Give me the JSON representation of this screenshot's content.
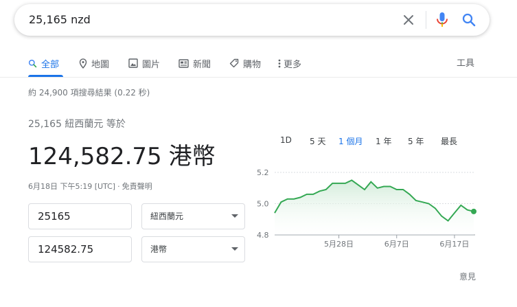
{
  "search": {
    "query": "25,165 nzd",
    "icons": [
      "close-icon",
      "mic-icon",
      "search-icon"
    ]
  },
  "tabs": {
    "items": [
      {
        "label": "全部",
        "icon": "search-icon",
        "active": true
      },
      {
        "label": "地圖",
        "icon": "map-pin-icon"
      },
      {
        "label": "圖片",
        "icon": "image-icon"
      },
      {
        "label": "新聞",
        "icon": "news-icon"
      },
      {
        "label": "購物",
        "icon": "tag-icon"
      },
      {
        "label": "更多",
        "icon": "more-vert-icon"
      }
    ],
    "tools_label": "工具"
  },
  "result_stats": "約 24,900 項搜尋結果 (0.22 秒)",
  "converter": {
    "source_label": "25,165 紐西蘭元 等於",
    "result_value": "124,582.75",
    "result_currency": "港幣",
    "timestamp": "6月18日 下午5:19 [UTC]",
    "separator": "·",
    "disclaimer": "免責聲明",
    "from_amount": "25165",
    "from_currency": "紐西蘭元",
    "to_amount": "124582.75",
    "to_currency": "港幣"
  },
  "range_tabs": [
    {
      "label": "1D"
    },
    {
      "label": "5 天"
    },
    {
      "label": "1 個月",
      "active": true
    },
    {
      "label": "1 年"
    },
    {
      "label": "5 年"
    },
    {
      "label": "最長"
    }
  ],
  "colors": {
    "accent": "#1a73e8",
    "chart_line": "#34a853",
    "chart_fill_top": "#ceead6"
  },
  "chart_data": {
    "type": "area",
    "y_ticks": [
      "5.2",
      "5.0",
      "4.8"
    ],
    "ylim": [
      4.8,
      5.2
    ],
    "x_ticks": [
      "5月28日",
      "6月7日",
      "6月17日"
    ],
    "x_tick_index": [
      10,
      19,
      28
    ],
    "values": [
      4.94,
      5.01,
      5.03,
      5.03,
      5.04,
      5.06,
      5.06,
      5.08,
      5.09,
      5.13,
      5.13,
      5.13,
      5.15,
      5.12,
      5.09,
      5.14,
      5.1,
      5.11,
      5.11,
      5.09,
      5.09,
      5.06,
      5.02,
      5.01,
      5.0,
      4.97,
      4.92,
      4.89,
      4.94,
      4.99,
      4.96,
      4.95
    ]
  },
  "feedback_label": "意見"
}
